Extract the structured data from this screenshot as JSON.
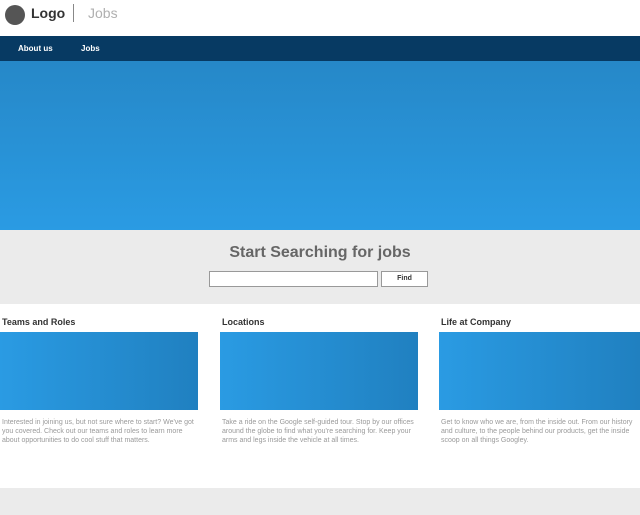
{
  "header": {
    "logo_text": "Logo",
    "section_name": "Jobs"
  },
  "nav": {
    "items": [
      {
        "label": "About us"
      },
      {
        "label": "Jobs"
      }
    ]
  },
  "search": {
    "title": "Start Searching for jobs",
    "input_value": "",
    "button_label": "Find"
  },
  "cards": [
    {
      "title": "Teams and Roles",
      "text": "Interested in joining us, but not sure where to start? We've got you covered. Check out our teams and roles to learn more about opportunities to do cool stuff that matters."
    },
    {
      "title": "Locations",
      "text": "Take a ride on the Google self-guided tour. Stop by our offices around the globe to find what you're searching for. Keep your arms and legs inside the vehicle at all times."
    },
    {
      "title": "Life at Company",
      "text": "Get to know who we are, from the inside out. From our history and culture, to the people behind our products, get the inside scoop on all things Googley."
    }
  ],
  "colors": {
    "nav_background": "#073a63",
    "hero_blue": "#2a9be3",
    "panel_gray": "#ebebeb"
  }
}
